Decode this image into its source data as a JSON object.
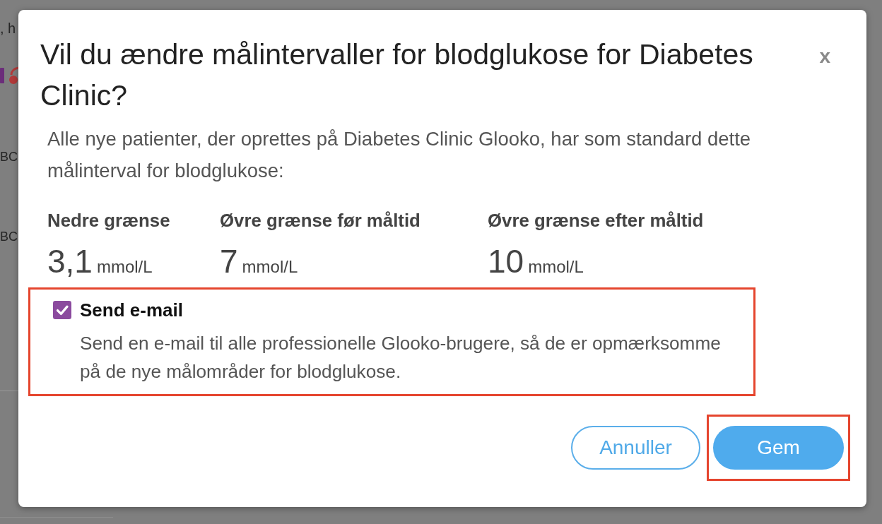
{
  "background_page": {
    "header_text": ", h",
    "rows": [
      "BC",
      "BC"
    ]
  },
  "dialog": {
    "title": "Vil du ændre målintervaller for blodglukose for Diabetes Clinic?",
    "close_label": "x",
    "intro": "Alle nye patienter, der oprettes på Diabetes Clinic Glooko, har som standard dette målinterval for blodglukose:",
    "limits": [
      {
        "label": "Nedre grænse",
        "value": "3,1",
        "unit": "mmol/L"
      },
      {
        "label": "Øvre grænse før måltid",
        "value": "7",
        "unit": "mmol/L"
      },
      {
        "label": "Øvre grænse efter måltid",
        "value": "10",
        "unit": "mmol/L"
      }
    ],
    "email_option": {
      "label": "Send e-mail",
      "description": "Send en e-mail til alle professionelle Glooko-brugere, så de er opmærksomme på de nye målområder for blodglukose.",
      "checked": true,
      "highlighted": true
    },
    "buttons": [
      {
        "label": "Annuller",
        "kind": "secondary",
        "highlighted": false
      },
      {
        "label": "Gem",
        "kind": "primary",
        "highlighted": true
      }
    ]
  }
}
